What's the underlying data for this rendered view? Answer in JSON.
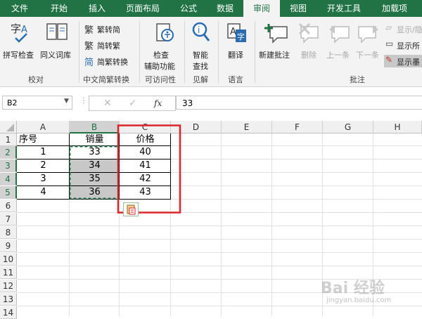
{
  "tabs": [
    "文件",
    "开始",
    "插入",
    "页面布局",
    "公式",
    "数据",
    "审阅",
    "视图",
    "开发工具",
    "加载项"
  ],
  "ribbon": {
    "proofing": {
      "spell": "拼写检查",
      "thesaurus": "同义词库",
      "group": "校对"
    },
    "chinese": {
      "to_trad": "繁转简",
      "to_simp": "简转繁",
      "convert": "简繁转换",
      "group": "中文简繁转换"
    },
    "access": {
      "check_line1": "检查",
      "check_line2": "辅助功能",
      "group": "可访问性"
    },
    "insights": {
      "smart_line1": "智能",
      "smart_line2": "查找",
      "group": "见解"
    },
    "language": {
      "translate": "翻译",
      "group": "语言"
    },
    "comments": {
      "new": "新建批注",
      "delete": "删除",
      "prev": "上一条",
      "next": "下一条",
      "show1": "显示/隐",
      "show2": "显示所",
      "show3": "显示墨",
      "group": "批注"
    }
  },
  "formula_bar": {
    "name_box": "B2",
    "fx": "fx",
    "value": "33"
  },
  "columns": [
    "A",
    "B",
    "C",
    "D",
    "E",
    "F",
    "G",
    "H"
  ],
  "rows": [
    "1",
    "2",
    "3",
    "4",
    "5",
    "6",
    "7",
    "8",
    "9",
    "10",
    "11",
    "12",
    "13",
    "14"
  ],
  "table": {
    "headers": [
      "序号",
      "销量",
      "价格"
    ],
    "rows": [
      [
        "1",
        "33",
        "40"
      ],
      [
        "2",
        "34",
        "41"
      ],
      [
        "3",
        "35",
        "42"
      ],
      [
        "4",
        "36",
        "43"
      ]
    ]
  },
  "watermark": "Bai 经验",
  "watermark_url": "jingyan.baidu.com",
  "colors": {
    "accent": "#217346",
    "highlight_box": "#d9252b",
    "selection_fill": "#c8c8c8"
  }
}
